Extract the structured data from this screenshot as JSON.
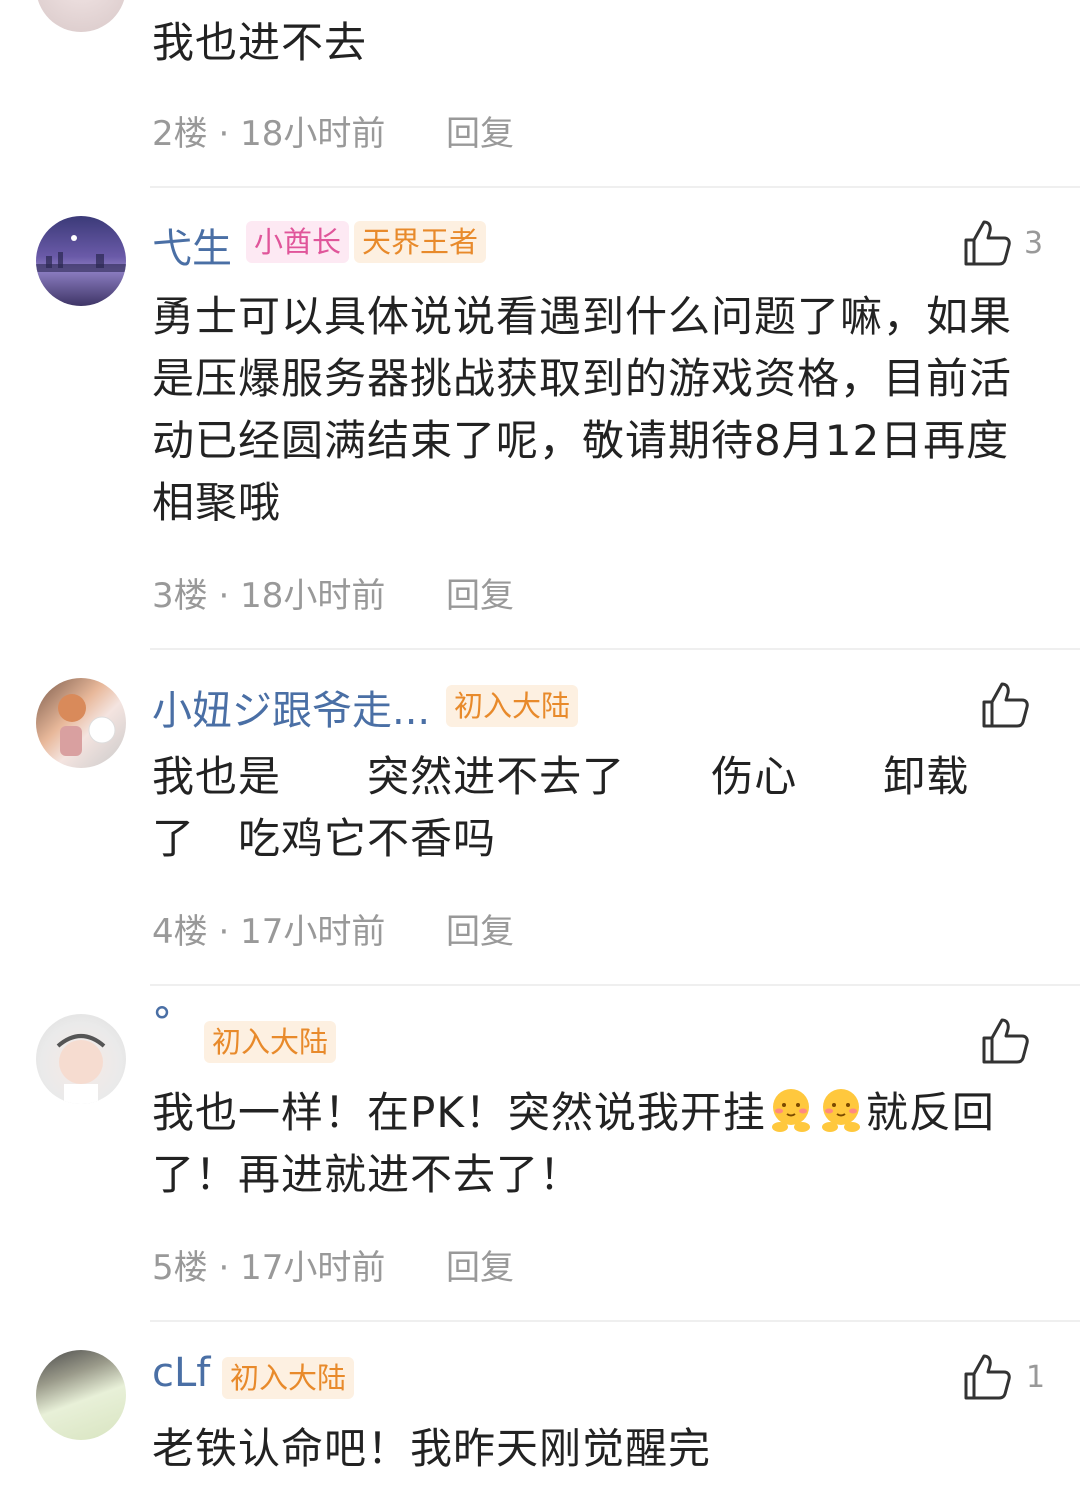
{
  "comments": [
    {
      "username": "",
      "badges": [],
      "text": "我也进不去",
      "floor": "2楼",
      "time": "18小时前",
      "reply": "回复",
      "likes": ""
    },
    {
      "username": "弋生",
      "badges": [
        "小酋长",
        "天界王者"
      ],
      "text": "勇士可以具体说说看遇到什么问题了嘛，如果是压爆服务器挑战获取到的游戏资格，目前活动已经圆满结束了呢，敬请期待8月12日再度相聚哦",
      "floor": "3楼",
      "time": "18小时前",
      "reply": "回复",
      "likes": "3"
    },
    {
      "username": "小妞ジ跟爷走...",
      "badges": [
        "初入大陆"
      ],
      "text": "我也是      突然进不去了      伤心      卸载了   吃鸡它不香吗",
      "floor": "4楼",
      "time": "17小时前",
      "reply": "回复",
      "likes": ""
    },
    {
      "username": "°",
      "badges": [
        "初入大陆"
      ],
      "text_before": "我也一样！在PK！突然说我开挂",
      "text_after": "就反回了！再进就进不去了！",
      "floor": "5楼",
      "time": "17小时前",
      "reply": "回复",
      "likes": ""
    },
    {
      "username": "cLf",
      "badges": [
        "初入大陆"
      ],
      "text": "老铁认命吧！我昨天刚觉醒完",
      "likes": "1"
    }
  ],
  "separator": " · ",
  "colors": {
    "username": "#4a6fa5",
    "meta": "#999999",
    "badge_pink": "#e0559a",
    "badge_orange": "#e88a2b"
  }
}
